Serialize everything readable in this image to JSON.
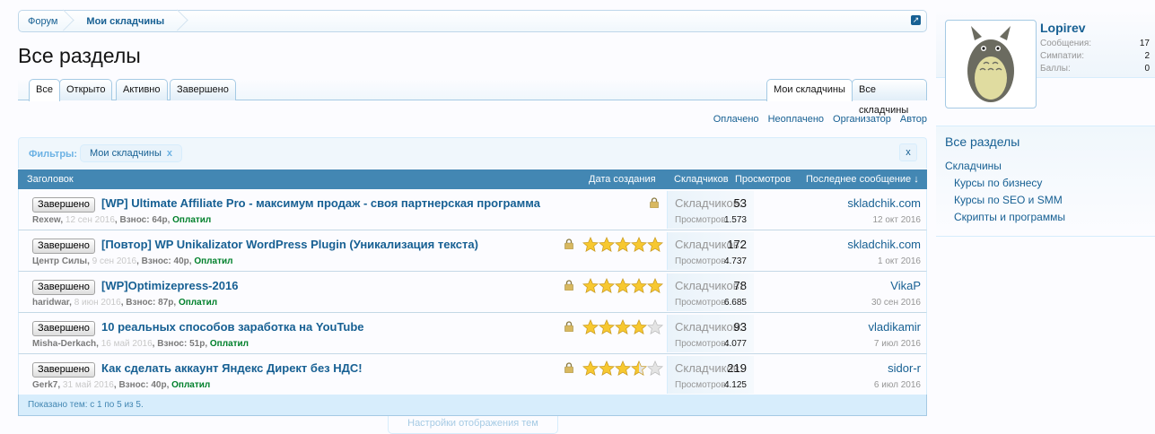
{
  "breadcrumb": {
    "items": [
      "Форум",
      "Мои складчины"
    ]
  },
  "page_title": "Все разделы",
  "tabs_left": [
    "Все",
    "Открыто",
    "Активно",
    "Завершено"
  ],
  "tabs_right": [
    "Мои складчины",
    "Все складчины"
  ],
  "filter_links": [
    "Оплачено",
    "Неоплачено",
    "Организатор",
    "Автор"
  ],
  "filters": {
    "label": "Фильтры:",
    "chip": "Мои складчины",
    "chip_remove": "x",
    "clear": "x"
  },
  "columns": {
    "title": "Заголовок",
    "created": "Дата создания",
    "members": "Складчиков",
    "views": "Просмотров",
    "last": "Последнее сообщение ↓"
  },
  "stats_labels": {
    "members": "Складчиков:",
    "views": "Просмотров:"
  },
  "threads": [
    {
      "prefix": "Завершено",
      "title": "[WP] Ultimate Affiliate Pro - максимум продаж - своя партнерская программа",
      "author": "Rexew",
      "date": "12 сен 2016",
      "fee": "Взнос: 64р",
      "status": "Оплатил",
      "rating": null,
      "members": "53",
      "views": "1.573",
      "last_user": "skladchik.com",
      "last_date": "12 окт 2016"
    },
    {
      "prefix": "Завершено",
      "title": "[Повтор] WP Unikalizator WordPress Plugin (Уникализация текста)",
      "author": "Центр Силы",
      "date": "9 сен 2016",
      "fee": "Взнос: 40р",
      "status": "Оплатил",
      "rating": 5,
      "members": "172",
      "views": "4.737",
      "last_user": "skladchik.com",
      "last_date": "1 окт 2016"
    },
    {
      "prefix": "Завершено",
      "title": "[WP]Optimizepress-2016",
      "author": "haridwar",
      "date": "8 июн 2016",
      "fee": "Взнос: 87р",
      "status": "Оплатил",
      "rating": 5,
      "members": "78",
      "views": "6.685",
      "last_user": "VikaP",
      "last_date": "30 сен 2016"
    },
    {
      "prefix": "Завершено",
      "title": "10 реальных способов заработка на YouTube",
      "author": "Misha-Derkach",
      "date": "16 май 2016",
      "fee": "Взнос: 51р",
      "status": "Оплатил",
      "rating": 4,
      "members": "93",
      "views": "4.077",
      "last_user": "vladikamir",
      "last_date": "7 июл 2016"
    },
    {
      "prefix": "Завершено",
      "title": "Как сделать аккаунт Яндекс Директ без НДС!",
      "author": "Gerk7",
      "date": "31 май 2016",
      "fee": "Взнос: 40р",
      "status": "Оплатил",
      "rating": 3.5,
      "members": "219",
      "views": "4.125",
      "last_user": "sidor-r",
      "last_date": "6 июл 2016"
    }
  ],
  "footer": "Показано тем: с 1 по 5 из 5.",
  "display_options": "Настройки отображения тем",
  "profile": {
    "name": "Lopirev",
    "stats": [
      {
        "label": "Сообщения:",
        "value": "17"
      },
      {
        "label": "Симпатии:",
        "value": "2"
      },
      {
        "label": "Баллы:",
        "value": "0"
      }
    ]
  },
  "sidebar": {
    "title": "Все разделы",
    "root": "Складчины",
    "items": [
      "Курсы по бизнесу",
      "Курсы по SEO и SMM",
      "Скрипты и программы"
    ]
  }
}
